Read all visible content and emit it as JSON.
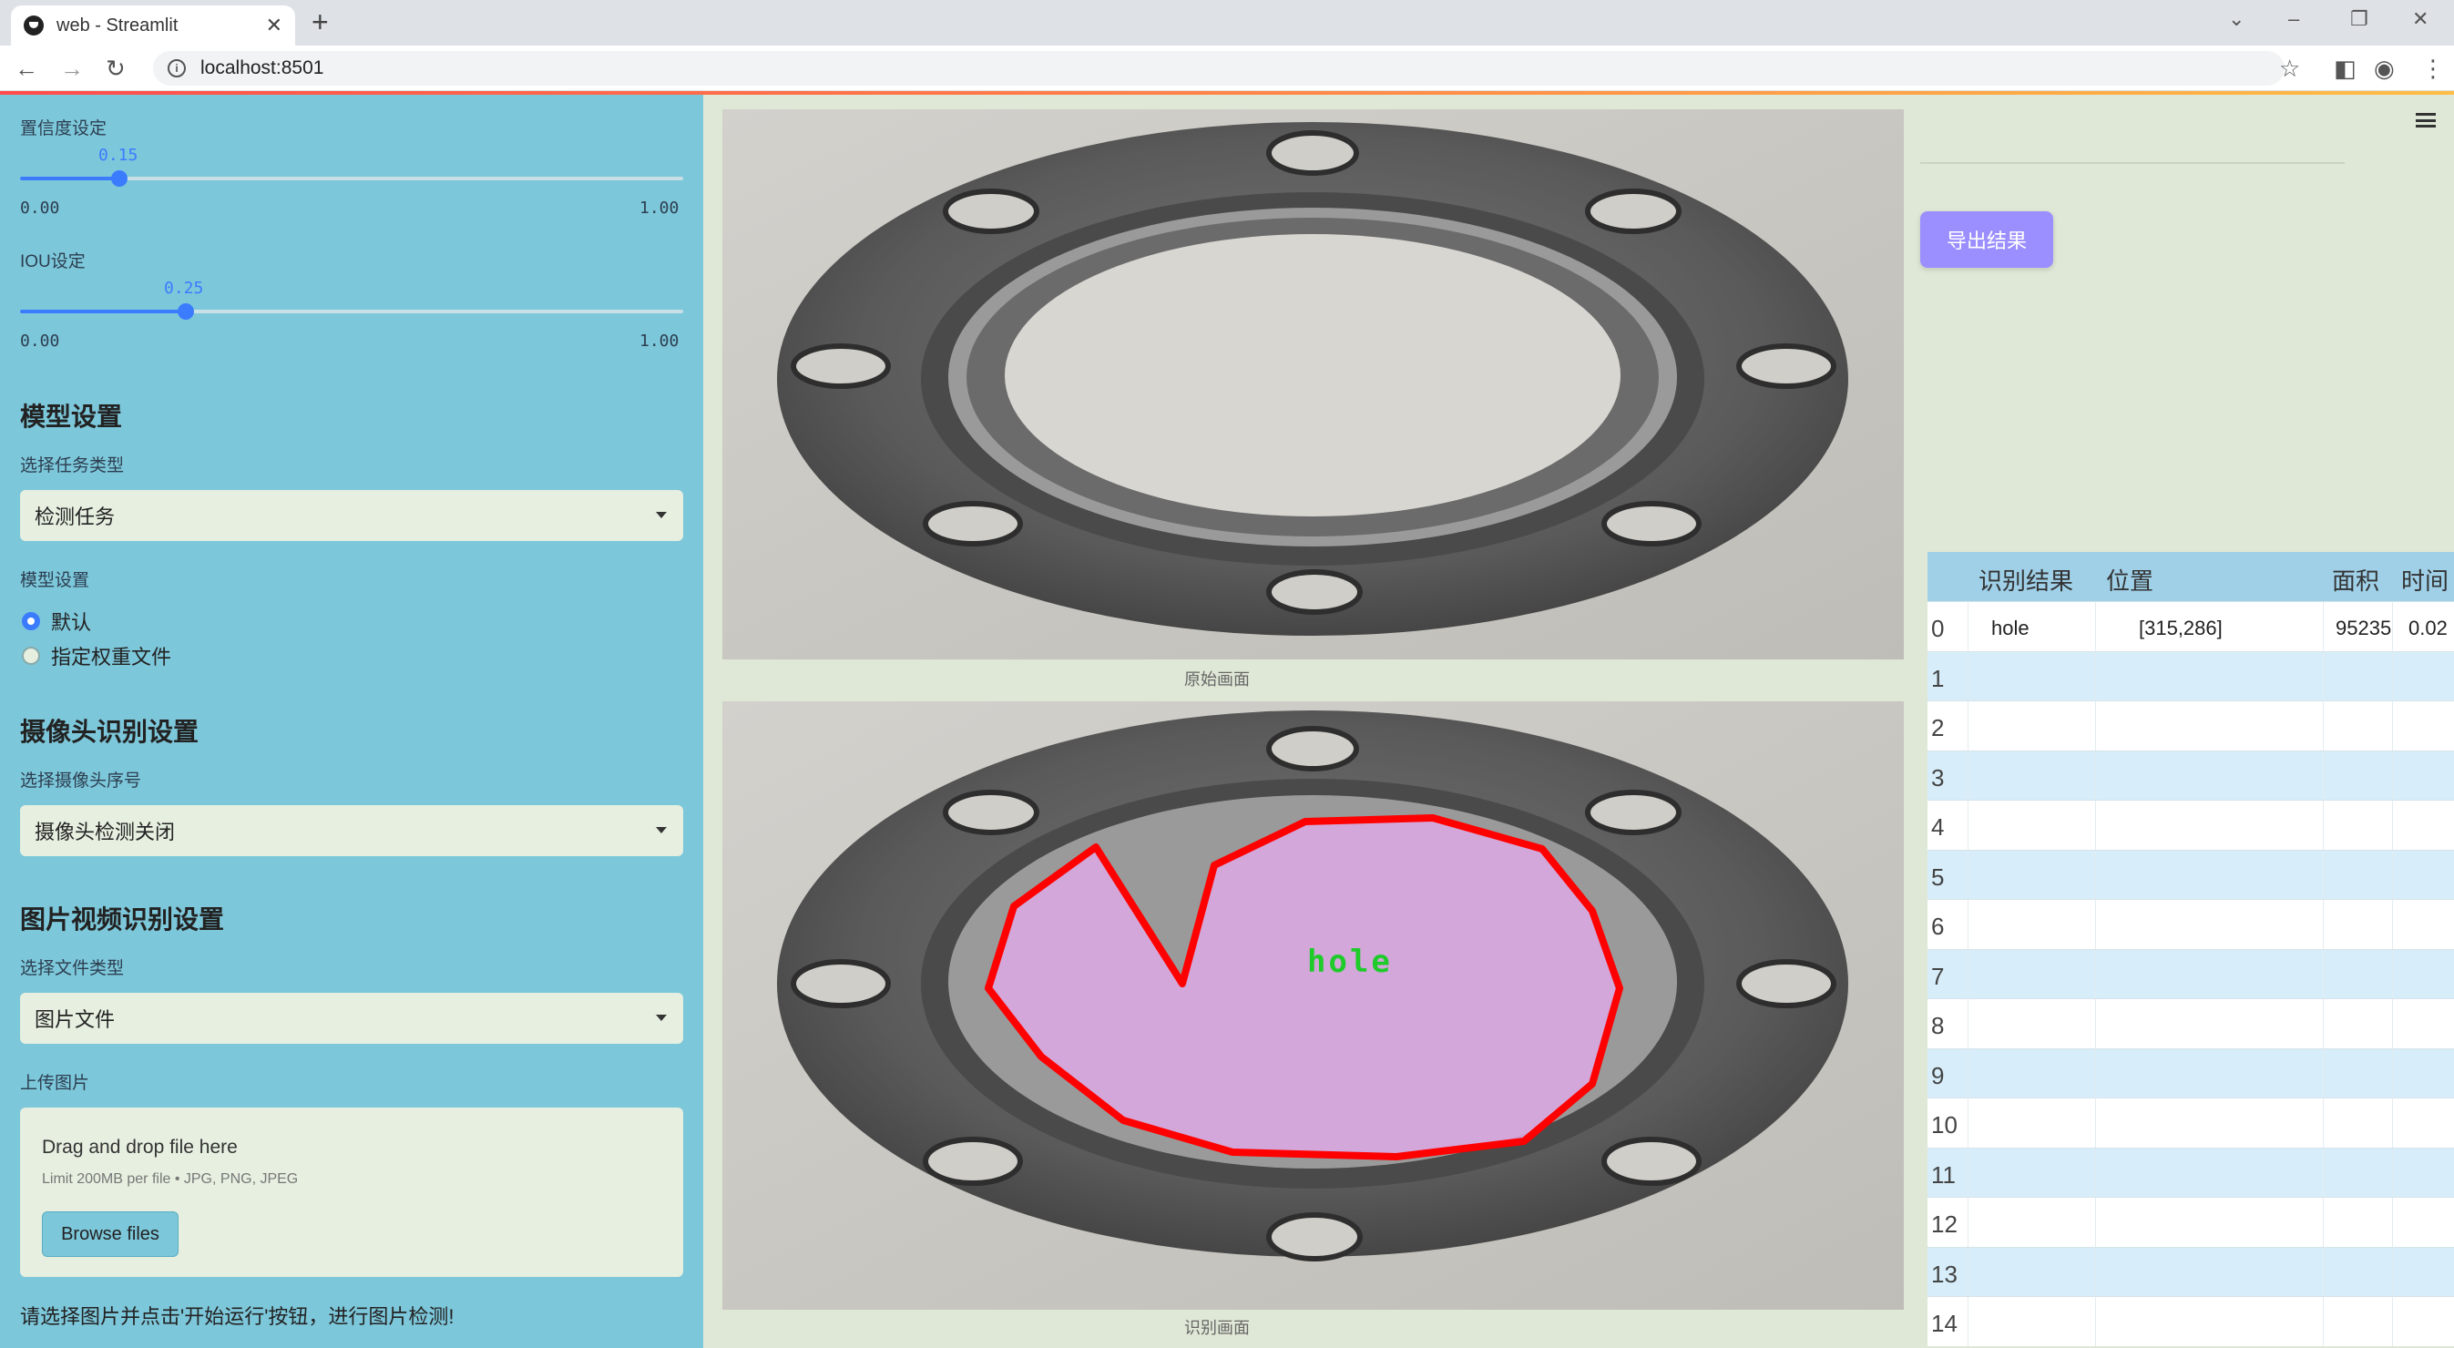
{
  "browser": {
    "tab_title": "web - Streamlit",
    "url": "localhost:8501"
  },
  "sidebar": {
    "confidence": {
      "label": "置信度设定",
      "value": "0.15",
      "min": "0.00",
      "max": "1.00",
      "fraction": 0.15
    },
    "iou": {
      "label": "IOU设定",
      "value": "0.25",
      "min": "0.00",
      "max": "1.00",
      "fraction": 0.25
    },
    "model_heading": "模型设置",
    "task_label": "选择任务类型",
    "task_value": "检测任务",
    "model_label": "模型设置",
    "radio_default": "默认",
    "radio_custom": "指定权重文件",
    "camera_heading": "摄像头识别设置",
    "camera_label": "选择摄像头序号",
    "camera_value": "摄像头检测关闭",
    "media_heading": "图片视频识别设置",
    "filetype_label": "选择文件类型",
    "filetype_value": "图片文件",
    "upload_label": "上传图片",
    "upload_drag": "Drag and drop file here",
    "upload_limit": "Limit 200MB per file • JPG, PNG, JPEG",
    "browse_label": "Browse files",
    "hint": "请选择图片并点击'开始运行'按钮，进行图片检测!"
  },
  "main": {
    "original_caption": "原始画面",
    "result_caption": "识别画面",
    "detection_label": "hole"
  },
  "right": {
    "export_label": "导出结果",
    "table": {
      "headers": [
        "识别结果",
        "位置",
        "面积",
        "时间"
      ],
      "rows": [
        {
          "index": "0",
          "result": "hole",
          "position": "[315,286]",
          "area": "95235",
          "time": "0.02"
        },
        {
          "index": "1"
        },
        {
          "index": "2"
        },
        {
          "index": "3"
        },
        {
          "index": "4"
        },
        {
          "index": "5"
        },
        {
          "index": "6"
        },
        {
          "index": "7"
        },
        {
          "index": "8"
        },
        {
          "index": "9"
        },
        {
          "index": "10"
        },
        {
          "index": "11"
        },
        {
          "index": "12"
        },
        {
          "index": "13"
        },
        {
          "index": "14"
        }
      ]
    }
  },
  "colors": {
    "sidebar_bg": "#7dc7da",
    "accent": "#3b7cff",
    "export_button": "#9b8fff",
    "detection_outline": "#ff0000",
    "detection_fill": "#d9a8e0",
    "detection_text": "#1ecb2a"
  }
}
